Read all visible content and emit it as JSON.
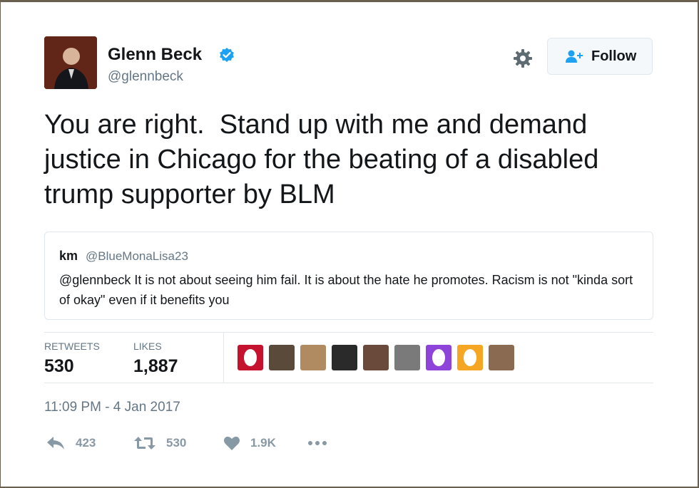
{
  "author": {
    "name": "Glenn Beck",
    "handle": "@glennbeck",
    "verified": true,
    "avatar": "profile-photo"
  },
  "header_actions": {
    "gear_icon": "gear-icon",
    "follow_label": "Follow",
    "follow_icon": "add-user-icon"
  },
  "tweet_text": "You are right.  Stand up with me and demand justice in Chicago for the beating of a disabled trump supporter by BLM",
  "quoted_tweet": {
    "name": "km",
    "handle": "@BlueMonaLisa23",
    "text": "@glennbeck  It is not about seeing him fail. It is about the hate he promotes. Racism is not \"kinda sort of okay\" even if it benefits you"
  },
  "stats": {
    "retweets_label": "RETWEETS",
    "retweets_value": "530",
    "likes_label": "LIKES",
    "likes_value": "1,887"
  },
  "likers": [
    {
      "type": "egg",
      "color": "#c4122f"
    },
    {
      "type": "photo",
      "color": "#5a4a3a"
    },
    {
      "type": "photo",
      "color": "#b08a60"
    },
    {
      "type": "photo",
      "color": "#2a2a2a"
    },
    {
      "type": "photo",
      "color": "#6a4a3a"
    },
    {
      "type": "photo",
      "color": "#7a7a7a"
    },
    {
      "type": "egg",
      "color": "#8e44d8"
    },
    {
      "type": "egg",
      "color": "#f5a623"
    },
    {
      "type": "photo",
      "color": "#8a6a50"
    }
  ],
  "timestamp": "11:09 PM - 4 Jan 2017",
  "actions": {
    "reply_count": "423",
    "retweet_count": "530",
    "like_count": "1.9K"
  },
  "colors": {
    "verified": "#1da1f2",
    "muted": "#657786",
    "action_grey": "#8899a6",
    "border": "#e1e8ed"
  }
}
